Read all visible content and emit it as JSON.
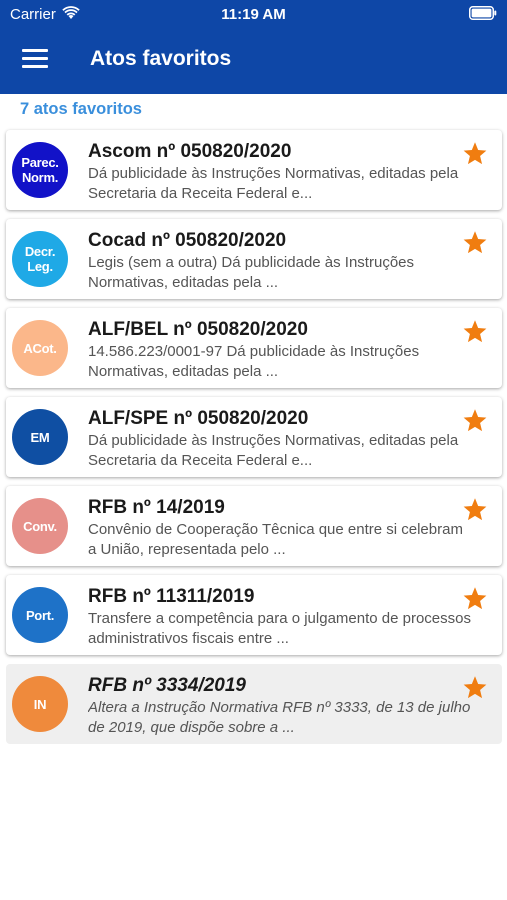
{
  "status_bar": {
    "carrier": "Carrier",
    "time": "11:19 AM"
  },
  "header": {
    "title": "Atos favoritos",
    "menu_icon": "hamburger-menu-icon"
  },
  "count_label": "7 atos favoritos",
  "colors": {
    "topbar": "#0e47a7",
    "accent": "#3a8fdc",
    "star": "#f07d10"
  },
  "items": [
    {
      "badge": "Parec.\nNorm.",
      "badge_color": "#1212c8",
      "title": "Ascom nº 050820/2020",
      "desc": "Dá publicidade às Instruções Normativas, editadas pela Secretaria da Receita Federal e...",
      "favorite": true
    },
    {
      "badge": "Decr.\nLeg.",
      "badge_color": "#1fa9e6",
      "title": "Cocad nº 050820/2020",
      "desc": "Legis (sem a outra) Dá publicidade às Instruções Normativas, editadas pela ...",
      "favorite": true
    },
    {
      "badge": "ACot.",
      "badge_color": "#fbb78a",
      "title": "ALF/BEL nº 050820/2020",
      "desc": "14.586.223/0001-97 Dá publicidade às Instruções Normativas, editadas pela ...",
      "favorite": true
    },
    {
      "badge": "EM",
      "badge_color": "#0f4fa3",
      "title": "ALF/SPE nº 050820/2020",
      "desc": "Dá publicidade às Instruções Normativas, editadas pela Secretaria da Receita Federal e...",
      "favorite": true
    },
    {
      "badge": "Conv.",
      "badge_color": "#e6908a",
      "title": "RFB nº 14/2019",
      "desc": "Convênio de Cooperação Têcnica que entre si celebram a União, representada pelo ...",
      "favorite": true
    },
    {
      "badge": "Port.",
      "badge_color": "#1e72c8",
      "title": "RFB nº 11311/2019",
      "desc": "Transfere a competência para o julgamento de processos administrativos fiscais entre ...",
      "favorite": true
    },
    {
      "badge": "IN",
      "badge_color": "#ef8a3c",
      "title": "RFB nº 3334/2019",
      "desc": "Altera  a Instrução Normativa RFB nº 3333, de 13 de julho de 2019, que dispõe sobre a ...",
      "favorite": true,
      "selected": true
    }
  ]
}
